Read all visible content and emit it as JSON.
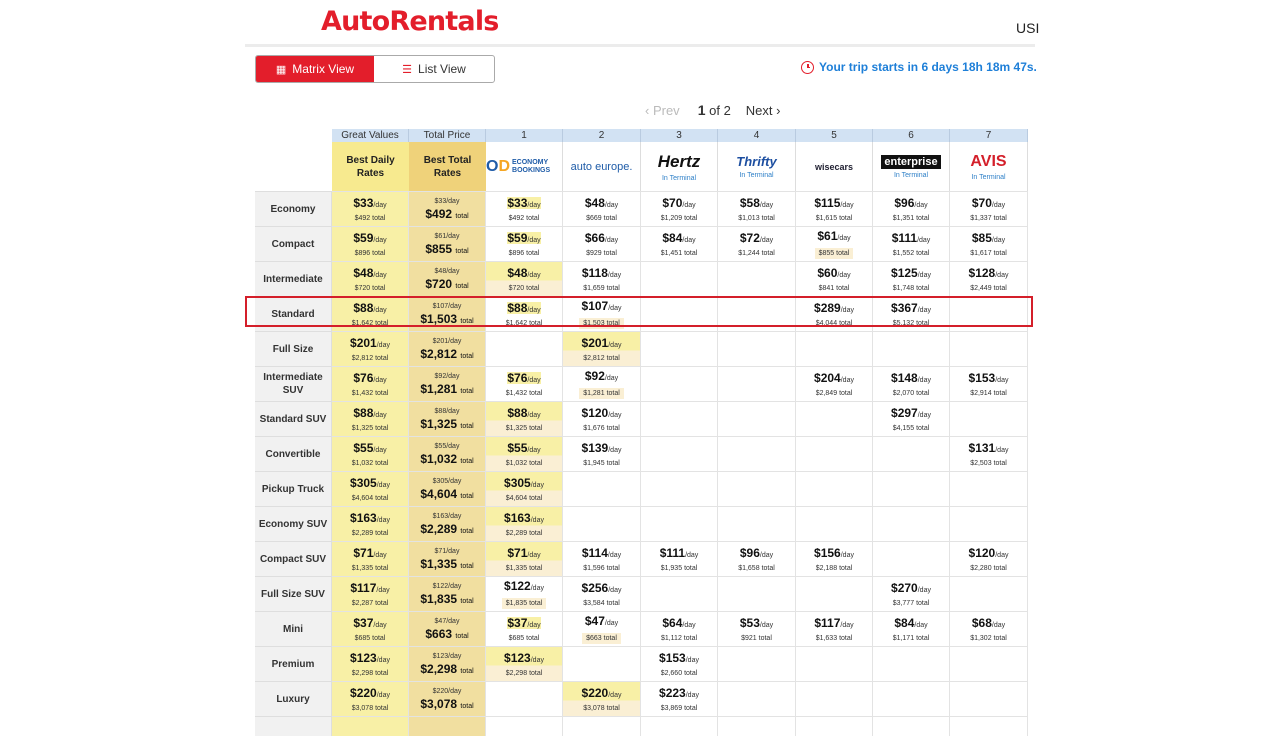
{
  "brand": {
    "name": "AutoRentals"
  },
  "header": {
    "currency": "USI"
  },
  "view_toggle": {
    "matrix_label": "Matrix View",
    "list_label": "List View"
  },
  "countdown": {
    "text": "Your trip starts in 6 days 18h 18m 47s."
  },
  "pagination": {
    "prev": "Prev",
    "current": "1",
    "of_text": "of 2",
    "next": "Next"
  },
  "matrix": {
    "col_headers": {
      "great_values": "Great Values",
      "total_price": "Total Price",
      "nums": [
        "1",
        "2",
        "3",
        "4",
        "5",
        "6",
        "7"
      ]
    },
    "best_headers": {
      "best_daily": "Best Daily Rates",
      "best_total": "Best Total Rates"
    },
    "suppliers": [
      {
        "name": "ECONOMY BOOKINGS",
        "sub": ""
      },
      {
        "name": "auto europe.",
        "sub": ""
      },
      {
        "name": "Hertz",
        "sub": "In Terminal"
      },
      {
        "name": "Thrifty",
        "sub": "In Terminal"
      },
      {
        "name": "wisecars",
        "sub": ""
      },
      {
        "name": "enterprise",
        "sub": "In Terminal"
      },
      {
        "name": "AVIS",
        "sub": "In Terminal"
      }
    ],
    "per_day_label": "/day",
    "total_label": "total",
    "rows": [
      {
        "label": "Economy",
        "gv": {
          "day": "$33",
          "total": "$492"
        },
        "tp": {
          "day": "$33",
          "total": "$492"
        },
        "cells": [
          {
            "day": "$33",
            "total": "$492",
            "hl": "top"
          },
          {
            "day": "$48",
            "total": "$669"
          },
          {
            "day": "$70",
            "total": "$1,209"
          },
          {
            "day": "$58",
            "total": "$1,013"
          },
          {
            "day": "$115",
            "total": "$1,615"
          },
          {
            "day": "$96",
            "total": "$1,351"
          },
          {
            "day": "$70",
            "total": "$1,337"
          }
        ]
      },
      {
        "label": "Compact",
        "gv": {
          "day": "$59",
          "total": "$896"
        },
        "tp": {
          "day": "$61",
          "total": "$855"
        },
        "cells": [
          {
            "day": "$59",
            "total": "$896",
            "hl": "top"
          },
          {
            "day": "$66",
            "total": "$929"
          },
          {
            "day": "$84",
            "total": "$1,451"
          },
          {
            "day": "$72",
            "total": "$1,244"
          },
          {
            "day": "$61",
            "total": "$855",
            "hl": "bot"
          },
          {
            "day": "$111",
            "total": "$1,552"
          },
          {
            "day": "$85",
            "total": "$1,617"
          }
        ]
      },
      {
        "label": "Intermediate",
        "gv": {
          "day": "$48",
          "total": "$720"
        },
        "tp": {
          "day": "$48",
          "total": "$720"
        },
        "cells": [
          {
            "day": "$48",
            "total": "$720",
            "hl": "both"
          },
          {
            "day": "$118",
            "total": "$1,659"
          },
          null,
          null,
          {
            "day": "$60",
            "total": "$841"
          },
          {
            "day": "$125",
            "total": "$1,748"
          },
          {
            "day": "$128",
            "total": "$2,449"
          }
        ]
      },
      {
        "label": "Standard",
        "gv": {
          "day": "$88",
          "total": "$1,642"
        },
        "tp": {
          "day": "$107",
          "total": "$1,503"
        },
        "cells": [
          {
            "day": "$88",
            "total": "$1,642",
            "hl": "top"
          },
          {
            "day": "$107",
            "total": "$1,503",
            "hl": "bot"
          },
          null,
          null,
          {
            "day": "$289",
            "total": "$4,044"
          },
          {
            "day": "$367",
            "total": "$5,132"
          },
          null
        ]
      },
      {
        "label": "Full Size",
        "gv": {
          "day": "$201",
          "total": "$2,812"
        },
        "tp": {
          "day": "$201",
          "total": "$2,812"
        },
        "cells": [
          null,
          {
            "day": "$201",
            "total": "$2,812",
            "hl": "both"
          },
          null,
          null,
          null,
          null,
          null
        ]
      },
      {
        "label": "Intermediate SUV",
        "gv": {
          "day": "$76",
          "total": "$1,432"
        },
        "tp": {
          "day": "$92",
          "total": "$1,281"
        },
        "cells": [
          {
            "day": "$76",
            "total": "$1,432",
            "hl": "top"
          },
          {
            "day": "$92",
            "total": "$1,281",
            "hl": "bot"
          },
          null,
          null,
          {
            "day": "$204",
            "total": "$2,849"
          },
          {
            "day": "$148",
            "total": "$2,070"
          },
          {
            "day": "$153",
            "total": "$2,914"
          }
        ]
      },
      {
        "label": "Standard SUV",
        "gv": {
          "day": "$88",
          "total": "$1,325"
        },
        "tp": {
          "day": "$88",
          "total": "$1,325"
        },
        "cells": [
          {
            "day": "$88",
            "total": "$1,325",
            "hl": "both"
          },
          {
            "day": "$120",
            "total": "$1,676"
          },
          null,
          null,
          null,
          {
            "day": "$297",
            "total": "$4,155"
          },
          null
        ]
      },
      {
        "label": "Convertible",
        "gv": {
          "day": "$55",
          "total": "$1,032"
        },
        "tp": {
          "day": "$55",
          "total": "$1,032"
        },
        "cells": [
          {
            "day": "$55",
            "total": "$1,032",
            "hl": "both"
          },
          {
            "day": "$139",
            "total": "$1,945"
          },
          null,
          null,
          null,
          null,
          {
            "day": "$131",
            "total": "$2,503"
          }
        ]
      },
      {
        "label": "Pickup Truck",
        "gv": {
          "day": "$305",
          "total": "$4,604"
        },
        "tp": {
          "day": "$305",
          "total": "$4,604"
        },
        "cells": [
          {
            "day": "$305",
            "total": "$4,604",
            "hl": "both"
          },
          null,
          null,
          null,
          null,
          null,
          null
        ]
      },
      {
        "label": "Economy SUV",
        "gv": {
          "day": "$163",
          "total": "$2,289"
        },
        "tp": {
          "day": "$163",
          "total": "$2,289"
        },
        "cells": [
          {
            "day": "$163",
            "total": "$2,289",
            "hl": "both"
          },
          null,
          null,
          null,
          null,
          null,
          null
        ]
      },
      {
        "label": "Compact SUV",
        "gv": {
          "day": "$71",
          "total": "$1,335"
        },
        "tp": {
          "day": "$71",
          "total": "$1,335"
        },
        "cells": [
          {
            "day": "$71",
            "total": "$1,335",
            "hl": "both"
          },
          {
            "day": "$114",
            "total": "$1,596"
          },
          {
            "day": "$111",
            "total": "$1,935"
          },
          {
            "day": "$96",
            "total": "$1,658"
          },
          {
            "day": "$156",
            "total": "$2,188"
          },
          null,
          {
            "day": "$120",
            "total": "$2,280"
          }
        ]
      },
      {
        "label": "Full Size SUV",
        "gv": {
          "day": "$117",
          "total": "$2,287"
        },
        "tp": {
          "day": "$122",
          "total": "$1,835"
        },
        "cells": [
          {
            "day": "$122",
            "total": "$1,835",
            "hl": "bot"
          },
          {
            "day": "$256",
            "total": "$3,584"
          },
          null,
          null,
          null,
          {
            "day": "$270",
            "total": "$3,777"
          },
          null
        ]
      },
      {
        "label": "Mini",
        "gv": {
          "day": "$37",
          "total": "$685"
        },
        "tp": {
          "day": "$47",
          "total": "$663"
        },
        "cells": [
          {
            "day": "$37",
            "total": "$685",
            "hl": "top"
          },
          {
            "day": "$47",
            "total": "$663",
            "hl": "bot"
          },
          {
            "day": "$64",
            "total": "$1,112"
          },
          {
            "day": "$53",
            "total": "$921"
          },
          {
            "day": "$117",
            "total": "$1,633"
          },
          {
            "day": "$84",
            "total": "$1,171"
          },
          {
            "day": "$68",
            "total": "$1,302"
          }
        ]
      },
      {
        "label": "Premium",
        "gv": {
          "day": "$123",
          "total": "$2,298"
        },
        "tp": {
          "day": "$123",
          "total": "$2,298"
        },
        "cells": [
          {
            "day": "$123",
            "total": "$2,298",
            "hl": "both"
          },
          null,
          {
            "day": "$153",
            "total": "$2,660"
          },
          null,
          null,
          null,
          null
        ]
      },
      {
        "label": "Luxury",
        "gv": {
          "day": "$220",
          "total": "$3,078"
        },
        "tp": {
          "day": "$220",
          "total": "$3,078"
        },
        "cells": [
          null,
          {
            "day": "$220",
            "total": "$3,078",
            "hl": "both"
          },
          {
            "day": "$223",
            "total": "$3,869"
          },
          null,
          null,
          null,
          null
        ]
      }
    ]
  }
}
